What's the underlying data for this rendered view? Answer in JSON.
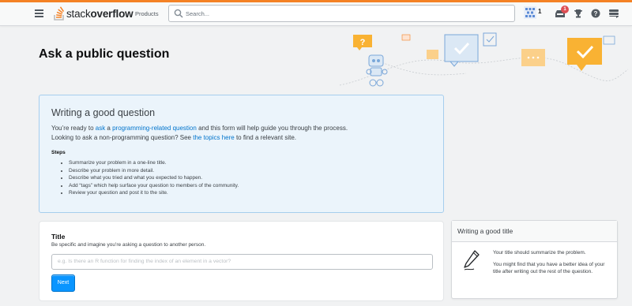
{
  "header": {
    "logo_light": "stack",
    "logo_bold": "overflow",
    "products_label": "Products",
    "search_placeholder": "Search...",
    "reputation": "1",
    "inbox_count": "1",
    "icons": [
      "menu-icon",
      "search-icon",
      "avatar",
      "inbox-icon",
      "trophy-icon",
      "help-icon",
      "site-switcher-icon"
    ]
  },
  "page": {
    "title": "Ask a public question"
  },
  "notice": {
    "heading": "Writing a good question",
    "p1_pre": "You’re ready to ",
    "p1_link1": "ask",
    "p1_mid": " a ",
    "p1_link2": "programming-related question",
    "p1_post": " and this form will help guide you through the process.",
    "p2_pre": "Looking to ask a non-programming question? See ",
    "p2_link": "the topics here",
    "p2_post": " to find a relevant site.",
    "steps_heading": "Steps",
    "steps": [
      "Summarize your problem in a one-line title.",
      "Describe your problem in more detail.",
      "Describe what you tried and what you expected to happen.",
      "Add “tags” which help surface your question to members of the community.",
      "Review your question and post it to the site."
    ]
  },
  "title_card": {
    "label": "Title",
    "description": "Be specific and imagine you’re asking a question to another person.",
    "input_value": "",
    "input_placeholder": "e.g. Is there an R function for finding the index of an element in a vector?",
    "next_label": "Next"
  },
  "side_card": {
    "heading": "Writing a good title",
    "p1": "Your title should summarize the problem.",
    "p2": "You might find that you have a better idea of your title after writing out the rest of the question."
  },
  "colors": {
    "accent": "#f48225",
    "primary_button": "#0a95ff",
    "link": "#0074cc",
    "notice_bg": "#ebf4fb",
    "notice_border": "#a6ceed",
    "badge": "#de4f54"
  }
}
